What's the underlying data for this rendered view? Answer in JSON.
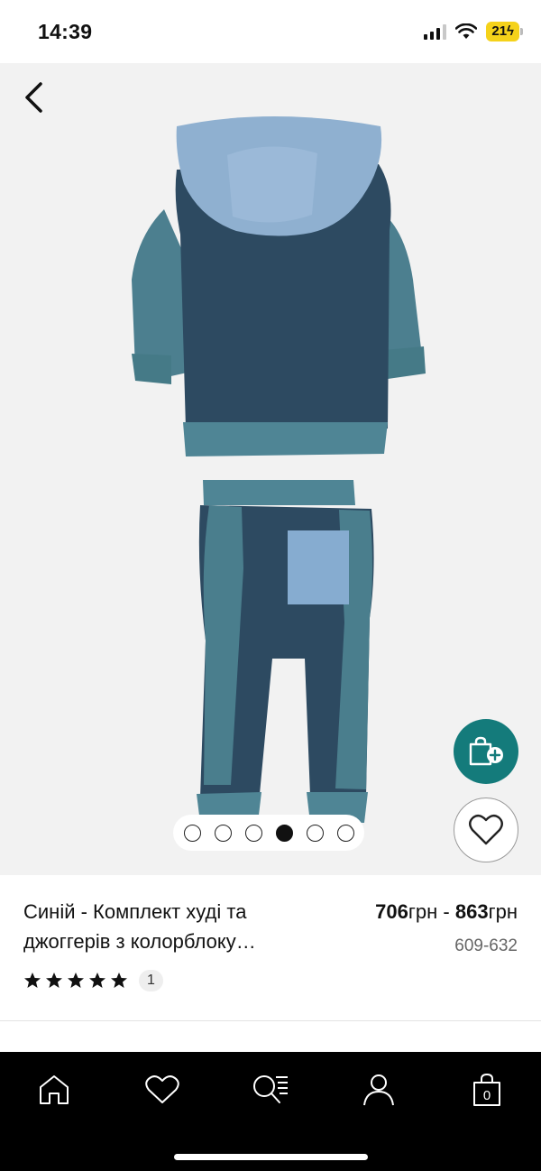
{
  "status_bar": {
    "time": "14:39",
    "battery": "21"
  },
  "product": {
    "title": "Синій - Комплект худі та джоггерів з колорблоку…",
    "price_from": "706",
    "price_to": "863",
    "currency": "грн",
    "price_separator": " - ",
    "size_range": "609-632",
    "rating_stars": 5,
    "review_count": "1"
  },
  "gallery": {
    "image_count": 6,
    "active_index": 3
  },
  "icons": {
    "back": "chevron-left-icon",
    "add_to_bag": "bag-plus-icon",
    "wishlist": "heart-icon",
    "nav_home": "home-icon",
    "nav_favourites": "heart-icon",
    "nav_search": "search-list-icon",
    "nav_account": "user-icon",
    "nav_bag": "bag-icon"
  },
  "bottom_nav": {
    "bag_count": "0"
  },
  "colors": {
    "accent": "#147b7b",
    "nav_background": "#000000",
    "image_background": "#f2f2f2"
  }
}
